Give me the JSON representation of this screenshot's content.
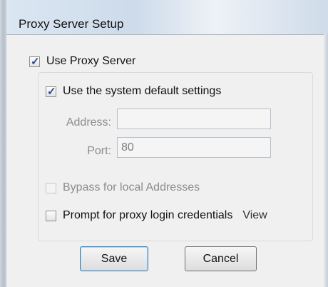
{
  "window": {
    "title": "Proxy Server Setup"
  },
  "use_proxy": {
    "label": "Use Proxy Server",
    "checked": true
  },
  "system_default": {
    "label": "Use the system default settings",
    "checked": true
  },
  "address": {
    "label": "Address:",
    "value": ""
  },
  "port": {
    "label": "Port:",
    "value": "80"
  },
  "bypass_local": {
    "label": "Bypass for local Addresses",
    "checked": false,
    "enabled": false
  },
  "prompt_credentials": {
    "label": "Prompt for proxy login credentials",
    "checked": false,
    "view_label": "View"
  },
  "buttons": {
    "save": "Save",
    "cancel": "Cancel"
  }
}
